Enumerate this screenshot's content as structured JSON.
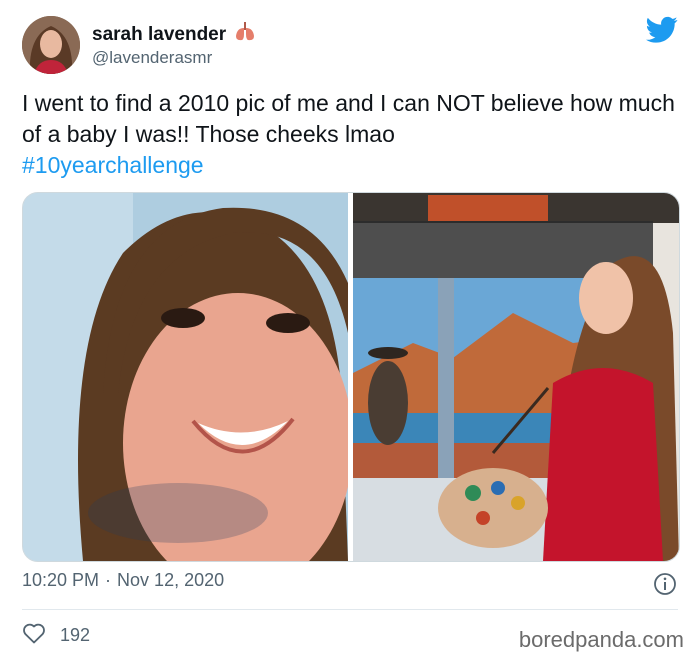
{
  "author": {
    "display_name": "sarah lavender",
    "handle": "@lavenderasmr",
    "name_emoji": "lungs-emoji"
  },
  "tweet": {
    "text": "I went to find a 2010 pic of me and I can NOT believe how much of a baby I was!! Those cheeks lmao",
    "hashtag": "#10yearchallenge"
  },
  "meta": {
    "time": "10:20 PM",
    "separator": "·",
    "date": "Nov 12, 2020"
  },
  "engagement": {
    "likes": "192"
  },
  "watermark": "boredpanda.com",
  "colors": {
    "twitter_blue": "#1d9bf0",
    "text": "#0f1419",
    "secondary": "#536471"
  },
  "icons": [
    "twitter-bird-icon",
    "info-icon",
    "heart-icon",
    "lungs-emoji"
  ]
}
